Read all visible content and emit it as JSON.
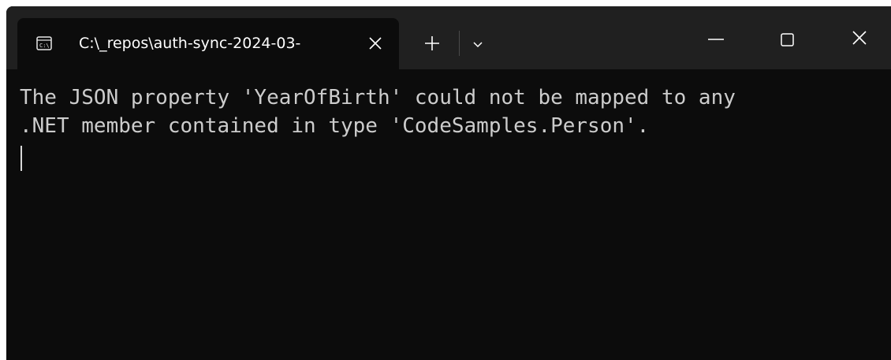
{
  "tab": {
    "title": "C:\\_repos\\auth-sync-2024-03-",
    "icon": "command-prompt-icon"
  },
  "titlebar": {
    "new_tab_icon": "plus-icon",
    "dropdown_icon": "chevron-down-icon",
    "minimize_icon": "minimize-icon",
    "maximize_icon": "maximize-icon",
    "close_icon": "close-icon"
  },
  "terminal": {
    "lines": [
      "The JSON property 'YearOfBirth' could not be mapped to any",
      ".NET member contained in type 'CodeSamples.Person'."
    ]
  },
  "colors": {
    "titlebar_bg": "#202020",
    "terminal_bg": "#0c0c0c",
    "terminal_text": "#cccccc"
  }
}
